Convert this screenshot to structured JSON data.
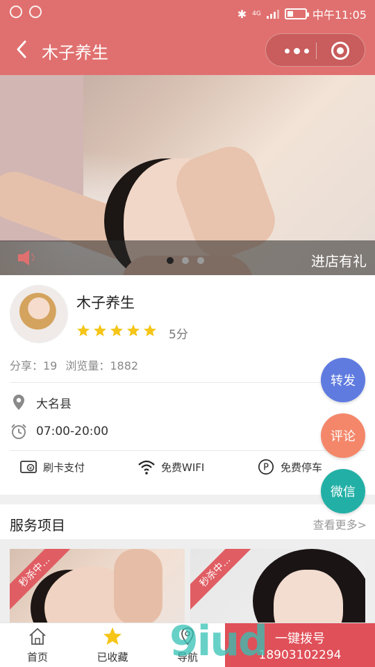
{
  "status_bar": {
    "time": "中午11:05",
    "network": "4G"
  },
  "nav": {
    "title": "木子养生",
    "icons": [
      "back-icon",
      "more-icon",
      "close-target-icon"
    ]
  },
  "banner": {
    "notice": "进店有礼",
    "slides_count": 3,
    "active_slide": 1
  },
  "shop": {
    "name": "木子养生",
    "rating": 5,
    "score_text": "5分",
    "shares_label": "分享：19",
    "views_label": "浏览量：1882",
    "location": "大名县",
    "hours": "07:00-20:00",
    "features": [
      {
        "icon": "card-payment-icon",
        "label": "刷卡支付"
      },
      {
        "icon": "wifi-icon",
        "label": "免费WIFI"
      },
      {
        "icon": "parking-icon",
        "label": "免费停车"
      }
    ]
  },
  "fabs": {
    "forward": {
      "label": "转发",
      "color": "#5f7be0"
    },
    "comment": {
      "label": "评论",
      "color": "#f4876a"
    },
    "wechat": {
      "label": "微信",
      "color": "#22b0a6"
    }
  },
  "services": {
    "title": "服务项目",
    "more": "查看更多>",
    "cards": [
      {
        "badge": "秒杀中..."
      },
      {
        "badge": "秒杀中..."
      }
    ]
  },
  "tabbar": {
    "tabs": [
      {
        "icon": "home-icon",
        "label": "首页"
      },
      {
        "icon": "star-icon",
        "label": "已收藏"
      },
      {
        "icon": "navigation-icon",
        "label": "导航"
      }
    ],
    "call_label": "一键拨号",
    "phone": "18903102294"
  },
  "watermark": "9iud",
  "colors": {
    "primary": "#e0706f",
    "star": "#f5c518",
    "call": "#e05059"
  }
}
